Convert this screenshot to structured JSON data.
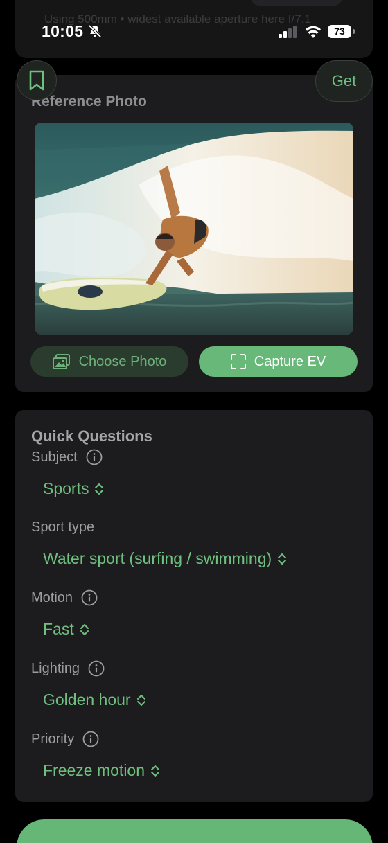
{
  "top_card": {
    "faded_text": "Using 500mm • widest available aperture here f/7.1"
  },
  "status_bar": {
    "time": "10:05",
    "battery": "73"
  },
  "floating": {
    "get_label": "Get"
  },
  "reference": {
    "title": "Reference Photo",
    "choose_label": "Choose Photo",
    "capture_label": "Capture EV"
  },
  "quick_questions": {
    "title": "Quick Questions",
    "items": [
      {
        "label": "Subject",
        "value": "Sports"
      },
      {
        "label": "Sport type",
        "value": "Water sport (surfing / swimming)"
      },
      {
        "label": "Motion",
        "value": "Fast"
      },
      {
        "label": "Lighting",
        "value": "Golden hour"
      },
      {
        "label": "Priority",
        "value": "Freeze motion"
      }
    ]
  },
  "colors": {
    "accent": "#67b879",
    "card": "#1c1c1e",
    "background": "#000000"
  }
}
